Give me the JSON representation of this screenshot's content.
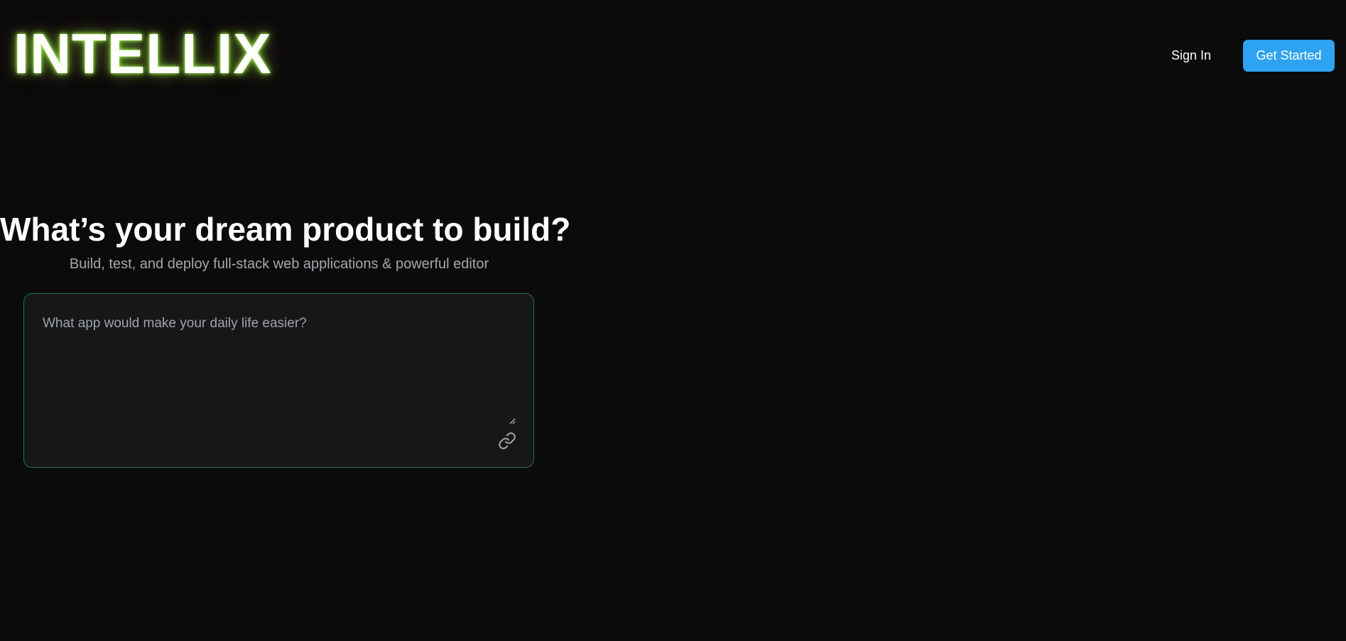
{
  "brand": {
    "name": "INTELLIX",
    "glow_color": "#9be34a"
  },
  "nav": {
    "sign_in_label": "Sign In",
    "get_started_label": "Get Started",
    "accent_color": "#2ea3f2"
  },
  "hero": {
    "title": "What’s your dream product to build?",
    "subtitle": "Build, test, and deploy full-stack web applications & powerful editor"
  },
  "prompt": {
    "value": "",
    "placeholder": "What app would make your daily life easier?",
    "border_color": "#1f6f68",
    "attach_icon": "link-icon"
  }
}
